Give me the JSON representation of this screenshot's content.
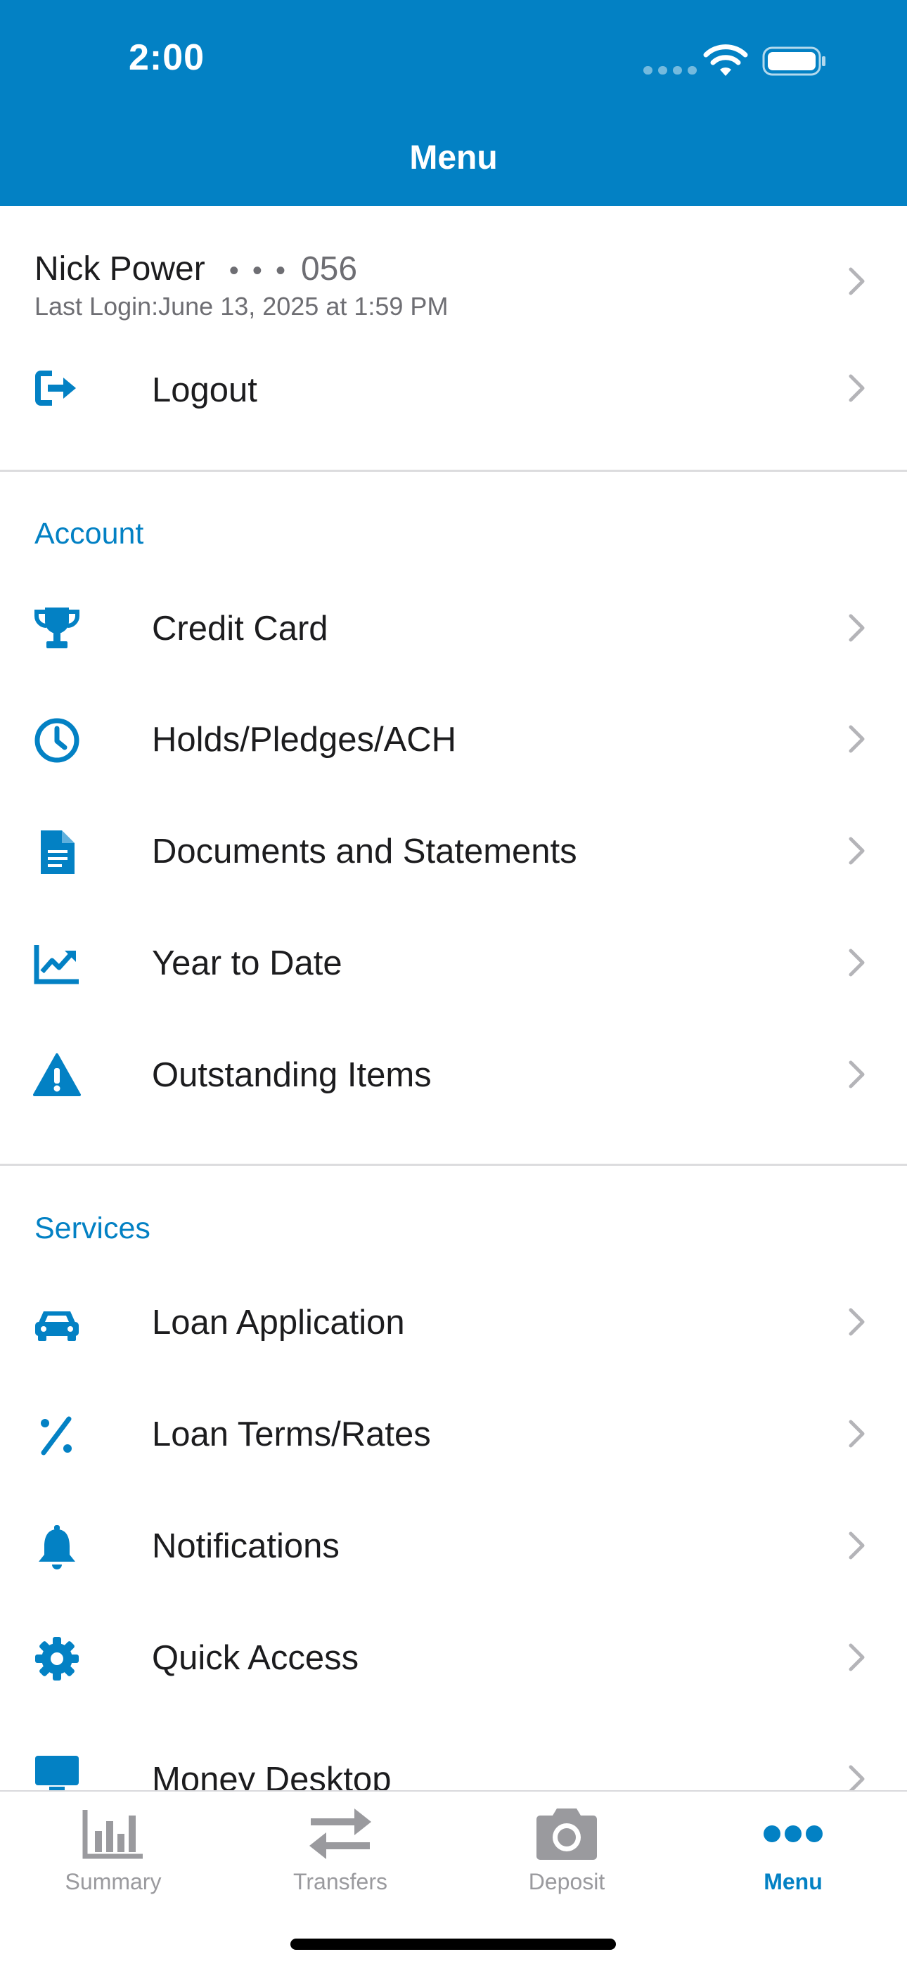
{
  "status_bar": {
    "time": "2:00"
  },
  "header": {
    "title": "Menu"
  },
  "user": {
    "name": "Nick Power",
    "dots": "• • •",
    "account": "056",
    "last_login": "Last Login:June 13, 2025 at 1:59 PM"
  },
  "logout": {
    "label": "Logout",
    "icon": "logout-icon"
  },
  "account_section": {
    "title": "Account",
    "items": [
      {
        "label": "Credit Card",
        "icon": "trophy-icon"
      },
      {
        "label": "Holds/Pledges/ACH",
        "icon": "clock-icon"
      },
      {
        "label": "Documents and Statements",
        "icon": "document-icon"
      },
      {
        "label": "Year to Date",
        "icon": "chart-line-icon"
      },
      {
        "label": "Outstanding Items",
        "icon": "warning-icon"
      }
    ]
  },
  "services_section": {
    "title": "Services",
    "items": [
      {
        "label": "Loan Application",
        "icon": "car-icon"
      },
      {
        "label": "Loan Terms/Rates",
        "icon": "percent-icon"
      },
      {
        "label": "Notifications",
        "icon": "bell-icon"
      },
      {
        "label": "Quick Access",
        "icon": "gear-icon"
      },
      {
        "label": "Money Desktop",
        "icon": "desktop-icon"
      }
    ]
  },
  "tabbar": {
    "tabs": [
      {
        "label": "Summary",
        "icon": "bar-chart-icon"
      },
      {
        "label": "Transfers",
        "icon": "transfer-arrows-icon"
      },
      {
        "label": "Deposit",
        "icon": "camera-icon"
      },
      {
        "label": "Menu",
        "icon": "more-dots-icon",
        "active": true
      }
    ]
  },
  "colors": {
    "brand": "#0381c4",
    "text": "#1c1c1e",
    "secondary": "#6e6e73",
    "chevron": "#b4b4b8",
    "tab_inactive": "#9a9a9e"
  }
}
